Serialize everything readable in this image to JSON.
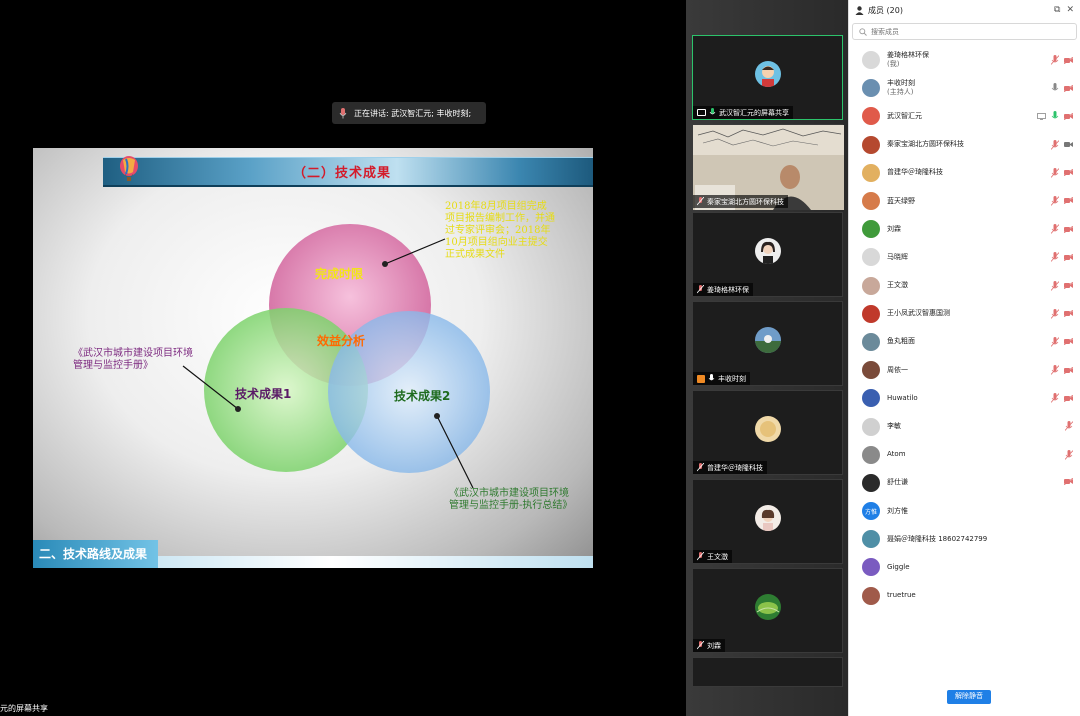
{
  "speaking_toast": {
    "text": "正在讲话: 武汉智汇元; 丰收时刻;"
  },
  "share_label": "元的屏幕共享",
  "slide": {
    "title": "（二）技术成果",
    "footer": "二、技术路线及成果",
    "venn": {
      "top": "完成时限",
      "center": "效益分析",
      "left": "技术成果1",
      "right": "技术成果2"
    },
    "annotations": {
      "time": "2018年8月项目组完成项目报告编制工作，并通过专家评审会；2018年10月项目组向业主提交正式成果文件",
      "tech1": "《武汉市城市建设项目环境管理与监控手册》",
      "tech2": "《武汉市城市建设项目环境管理与监控手册-执行总结》"
    }
  },
  "gallery": [
    {
      "name": "武汉智汇元的屏幕共享",
      "active": true
    },
    {
      "name": "秦家宝湖北方圆环保科技",
      "video": true
    },
    {
      "name": "姜琦格林环保"
    },
    {
      "name": "丰收时刻"
    },
    {
      "name": "曾建华＠琦隆科技"
    },
    {
      "name": "王文澂"
    },
    {
      "name": "刘霖"
    }
  ],
  "panel": {
    "title": "成员 (20)",
    "search_placeholder": "搜索成员",
    "unmute_label": "解除静音",
    "members": [
      {
        "name": "姜琦格林环保",
        "role": "(我)",
        "color": "#d9d9d9",
        "mic": "muted",
        "video": "off"
      },
      {
        "name": "丰收时刻",
        "role": "(主持人)",
        "color": "#6a8fb0",
        "mic": "on",
        "video": "off"
      },
      {
        "name": "武汉智汇元",
        "role": "",
        "color": "#e05a4a",
        "mic": "active",
        "video": "off",
        "share": true
      },
      {
        "name": "秦家宝湖北方圆环保科技",
        "role": "",
        "color": "#b5492f",
        "mic": "muted",
        "video": "on"
      },
      {
        "name": "曾建华＠琦隆科技",
        "role": "",
        "color": "#e2b060",
        "mic": "muted",
        "video": "off"
      },
      {
        "name": "蓝天绿野",
        "role": "",
        "color": "#d67b4a",
        "mic": "muted",
        "video": "off"
      },
      {
        "name": "刘霖",
        "role": "",
        "color": "#3f9a3a",
        "mic": "muted",
        "video": "off"
      },
      {
        "name": "马晓辉",
        "role": "",
        "color": "#d8d8d8",
        "mic": "muted",
        "video": "off"
      },
      {
        "name": "王文澂",
        "role": "",
        "color": "#c8a89a",
        "mic": "muted",
        "video": "off"
      },
      {
        "name": "王小凤武汉智惠国测",
        "role": "",
        "color": "#c0392b",
        "mic": "muted",
        "video": "off"
      },
      {
        "name": "鱼丸粗面",
        "role": "",
        "color": "#6b8a9a",
        "mic": "muted",
        "video": "off"
      },
      {
        "name": "周依一",
        "role": "",
        "color": "#7a4b3a",
        "mic": "muted",
        "video": "off"
      },
      {
        "name": "Huwatilo",
        "role": "",
        "color": "#3a5fb0",
        "mic": "muted",
        "video": "off"
      },
      {
        "name": "李敏",
        "role": "",
        "color": "#d0d0d0",
        "mic": "muted",
        "video": "none"
      },
      {
        "name": "Atom",
        "role": "",
        "color": "#8a8a8a",
        "mic": "muted",
        "video": "none"
      },
      {
        "name": "舒仕谦",
        "role": "",
        "color": "#2a2a2a",
        "mic": "none",
        "video": "off"
      },
      {
        "name": "刘方惟",
        "role": "",
        "color": "#1f7fe6",
        "mic": "none",
        "video": "none",
        "initials": "方惟"
      },
      {
        "name": "聂娟＠琦隆科技 18602742799",
        "role": "",
        "color": "#4f8fa6",
        "mic": "none",
        "video": "none"
      },
      {
        "name": "Giggle",
        "role": "",
        "color": "#7a5bc0",
        "mic": "none",
        "video": "none"
      },
      {
        "name": "truetrue",
        "role": "",
        "color": "#a05a4a",
        "mic": "none",
        "video": "none"
      }
    ]
  }
}
